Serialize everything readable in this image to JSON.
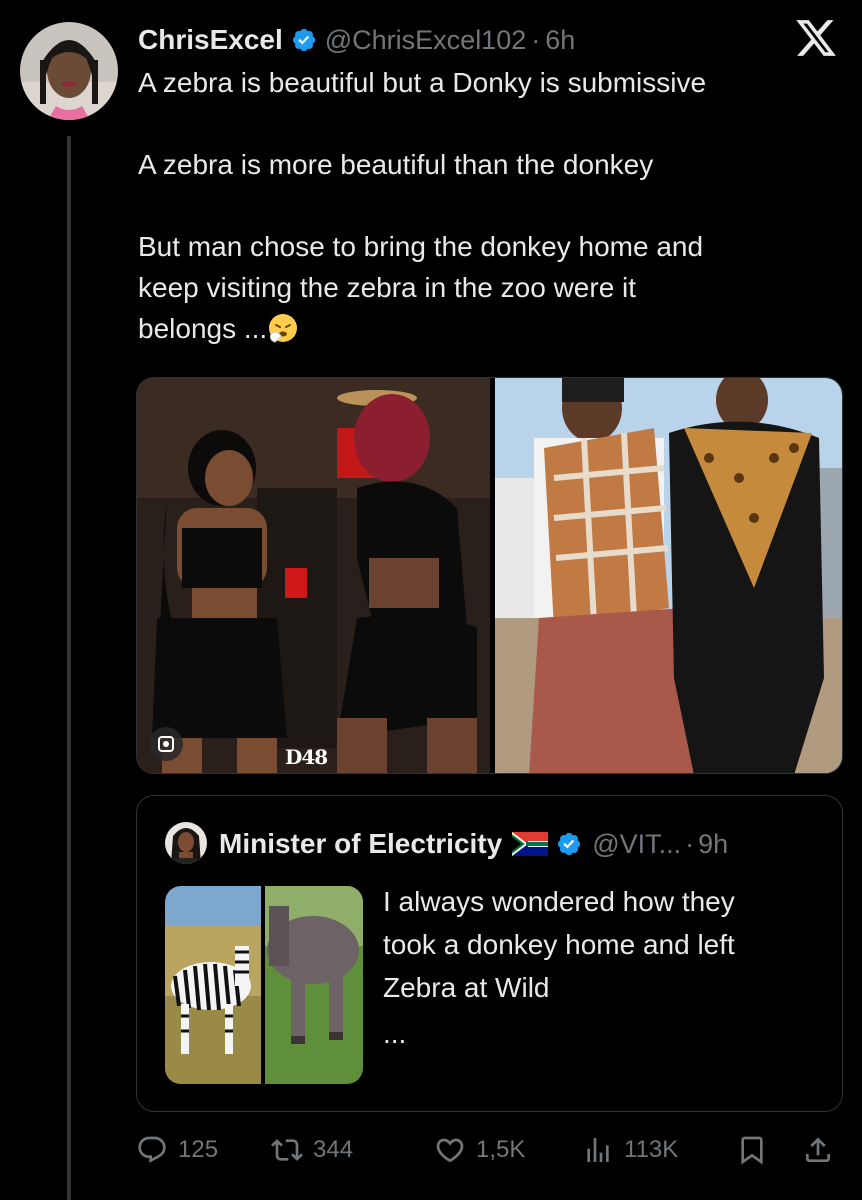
{
  "tweet": {
    "display_name": "ChrisExcel",
    "handle": "@ChrisExcel102",
    "separator": "·",
    "time": "6h",
    "text_lines": [
      "A zebra is beautiful but a Donky is submissive",
      "A zebra is more beautiful than the donkey",
      "But man chose to bring the donkey home and",
      "keep visiting the zebra in the zoo were it",
      "belongs ..."
    ],
    "emoji": "sneezing-face",
    "media": {
      "left_watermark": "D48",
      "left_alt": "photo of two women at a party",
      "right_alt": "photo of a couple in traditional blanket attire"
    }
  },
  "quote": {
    "display_name": "Minister of Electricity",
    "handle": "@VIT...",
    "separator": "·",
    "time": "9h",
    "text_lines": [
      "I always wondered how they",
      "took a donkey home and left",
      "Zebra at Wild"
    ],
    "ellipsis": "..."
  },
  "actions": {
    "replies": "125",
    "retweets": "344",
    "likes": "1,5K",
    "views": "113K"
  },
  "colors": {
    "background": "#000000",
    "text": "#e7e9ea",
    "muted": "#71767b",
    "verified": "#1d9bf0",
    "border": "#2f3336"
  }
}
